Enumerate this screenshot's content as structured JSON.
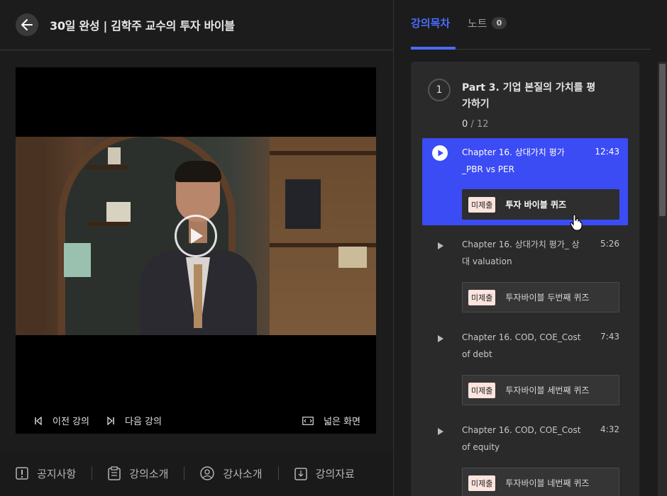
{
  "header": {
    "title": "30일 완성 | 김학주 교수의 투자 바이블",
    "back_icon": "arrow-left-icon"
  },
  "player": {
    "prev_label": "이전 강의",
    "next_label": "다음 강의",
    "wide_label": "넓은 화면"
  },
  "bottom_tabs": [
    {
      "label": "공지사항",
      "icon": "alert-icon"
    },
    {
      "label": "강의소개",
      "icon": "clipboard-icon"
    },
    {
      "label": "강사소개",
      "icon": "user-icon"
    },
    {
      "label": "강의자료",
      "icon": "download-icon"
    }
  ],
  "right_tabs": {
    "active": "강의목차",
    "note": "노트",
    "note_count": "0"
  },
  "part": {
    "number": "1",
    "title": "Part 3. 기업 본질의 가치를 평가하기",
    "done": "0",
    "sep": "/",
    "total": "12"
  },
  "lectures": [
    {
      "title": "Chapter 16. 상대가치 평가 _PBR vs PER",
      "time": "12:43",
      "quiz_badge": "미제출",
      "quiz_title": "투자 바이블 퀴즈",
      "active": true
    },
    {
      "title": "Chapter 16. 상대가치 평가_ 상대 valuation",
      "time": "5:26",
      "quiz_badge": "미제출",
      "quiz_title": "투자바이블 두번째 퀴즈",
      "active": false
    },
    {
      "title": "Chapter 16. COD, COE_Cost of debt",
      "time": "7:43",
      "quiz_badge": "미제출",
      "quiz_title": "투자바이블 세번째 퀴즈",
      "active": false
    },
    {
      "title": "Chapter 16. COD, COE_Cost of equity",
      "time": "4:32",
      "quiz_badge": "미제출",
      "quiz_title": "투자바이블 네번째 퀴즈",
      "active": false
    }
  ],
  "colors": {
    "accent": "#3b4cf5",
    "tab_active": "#4b6bff",
    "badge_bg": "#fde4de"
  }
}
